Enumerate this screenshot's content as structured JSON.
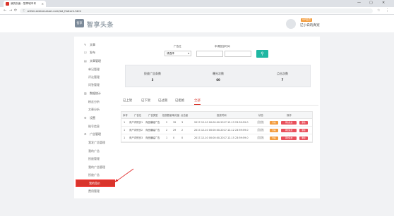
{
  "browser": {
    "tab_title": "我的页面 - 智享城市号",
    "tab_close": "×",
    "url": "writer.zsteod.zaoci.com/ad_feature.html",
    "window_controls": [
      "—",
      "▢",
      "✕"
    ],
    "nav": {
      "back": "←",
      "forward": "→",
      "reload": "⟳"
    },
    "star": "☆",
    "menu": "⋮"
  },
  "header": {
    "logo_mark": "智享",
    "logo_text": "智享头条",
    "user_badge": "VIP会员",
    "user_name": "辽小白的真宠"
  },
  "sidebar": {
    "items": [
      {
        "label": "文章",
        "icon": "✎",
        "type": "group"
      },
      {
        "label": "发布",
        "icon": "☑",
        "type": "group"
      },
      {
        "label": "文章管理",
        "icon": "▤",
        "type": "group"
      },
      {
        "label": "单记管理",
        "type": "sub"
      },
      {
        "label": "评论管理",
        "type": "sub"
      },
      {
        "label": "问答管理",
        "type": "sub"
      },
      {
        "label": "数据统计",
        "icon": "▥",
        "type": "group"
      },
      {
        "label": "粉丝分析",
        "type": "sub"
      },
      {
        "label": "文章分析",
        "type": "sub"
      },
      {
        "label": "设置",
        "icon": "⚙",
        "type": "group"
      },
      {
        "label": "账号信息",
        "type": "sub"
      },
      {
        "label": "广告管理",
        "icon": "⚙",
        "type": "group"
      },
      {
        "label": "我发广告管理",
        "type": "sub"
      },
      {
        "label": "我的广告",
        "type": "sub"
      },
      {
        "label": "投放管理",
        "type": "sub"
      },
      {
        "label": "我的广告管理",
        "type": "sub"
      },
      {
        "label": "投放广告",
        "type": "sub"
      },
      {
        "label": "我的竞价",
        "type": "sub",
        "active": true
      },
      {
        "label": "费用管理",
        "type": "sub"
      }
    ]
  },
  "filters": {
    "ad_position_label": "广告位",
    "ad_position_value": "请选择",
    "date_label": "申请投放时间",
    "search_icon": "⚲"
  },
  "stats": [
    {
      "label": "投放广告条数",
      "value": "3"
    },
    {
      "label": "曝光次数",
      "value": "60"
    },
    {
      "label": "点击次数",
      "value": "7"
    }
  ],
  "tabs": [
    "已上架",
    "已下架",
    "已过期",
    "已拒绝",
    "全部"
  ],
  "active_tab": "全部",
  "table": {
    "headers": [
      "序号",
      "广告位",
      "广告类型",
      "投放数量",
      "曝光量",
      "点击量",
      "投放时间",
      "状态",
      "操作"
    ],
    "rows": [
      {
        "no": "1",
        "position": "商户详情页1",
        "type": "商品横幅广告",
        "qty": "2",
        "views": "39",
        "clicks": "3",
        "time": "2017-12-10 00:00:00-2017-12-13 23:59:59.0",
        "status": "已上架"
      },
      {
        "no": "1",
        "position": "商户详情页2",
        "type": "商品横幅广告",
        "qty": "2",
        "views": "29",
        "clicks": "2",
        "time": "2017-12-10 00:00:00-2017-12-12 23:59:59.0",
        "status": "已上架"
      },
      {
        "no": "1",
        "position": "商户详情页3",
        "type": "商品横幅广告",
        "qty": "1",
        "views": "0",
        "clicks": "0",
        "time": "2017-12-10 00:00:00-2017-12-15 23:59:59.0",
        "status": "已上架"
      }
    ],
    "actions": {
      "view": "查看",
      "edit": "再次投放",
      "delete": "删除"
    }
  }
}
